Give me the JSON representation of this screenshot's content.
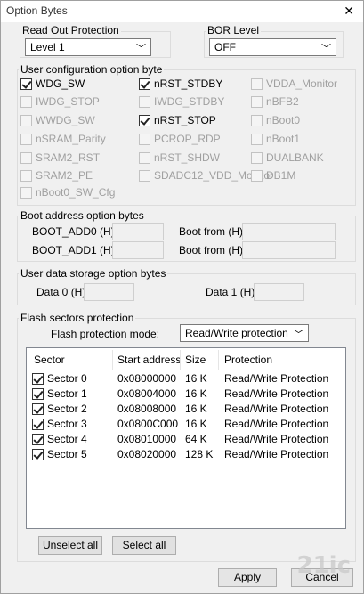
{
  "window": {
    "title": "Option Bytes"
  },
  "rop": {
    "label": "Read Out Protection",
    "value": "Level 1"
  },
  "bor": {
    "label": "BOR Level",
    "value": "OFF"
  },
  "user_config": {
    "title": "User configuration option byte",
    "options": [
      {
        "label": "WDG_SW",
        "checked": true,
        "enabled": true
      },
      {
        "label": "nRST_STDBY",
        "checked": true,
        "enabled": true
      },
      {
        "label": "VDDA_Monitor",
        "checked": false,
        "enabled": false
      },
      {
        "label": "IWDG_STOP",
        "checked": false,
        "enabled": false
      },
      {
        "label": "IWDG_STDBY",
        "checked": false,
        "enabled": false
      },
      {
        "label": "nBFB2",
        "checked": false,
        "enabled": false
      },
      {
        "label": "WWDG_SW",
        "checked": false,
        "enabled": false
      },
      {
        "label": "nRST_STOP",
        "checked": true,
        "enabled": true
      },
      {
        "label": "nBoot0",
        "checked": false,
        "enabled": false
      },
      {
        "label": "nSRAM_Parity",
        "checked": false,
        "enabled": false
      },
      {
        "label": "PCROP_RDP",
        "checked": false,
        "enabled": false
      },
      {
        "label": "nBoot1",
        "checked": false,
        "enabled": false
      },
      {
        "label": "SRAM2_RST",
        "checked": false,
        "enabled": false
      },
      {
        "label": "nRST_SHDW",
        "checked": false,
        "enabled": false
      },
      {
        "label": "DUALBANK",
        "checked": false,
        "enabled": false
      },
      {
        "label": "SRAM2_PE",
        "checked": false,
        "enabled": false
      },
      {
        "label": "SDADC12_VDD_Monitor",
        "checked": false,
        "enabled": false
      },
      {
        "label": "DB1M",
        "checked": false,
        "enabled": false
      },
      {
        "label": "nBoot0_SW_Cfg",
        "checked": false,
        "enabled": false
      }
    ]
  },
  "boot": {
    "title": "Boot address option bytes",
    "add0_label": "BOOT_ADD0 (H)",
    "add1_label": "BOOT_ADD1 (H)",
    "from_label_0": "Boot from (H)",
    "from_label_1": "Boot from (H)"
  },
  "user_data": {
    "title": "User data storage option bytes",
    "data0_label": "Data 0 (H)",
    "data1_label": "Data 1 (H)"
  },
  "flash": {
    "title": "Flash sectors protection",
    "mode_label": "Flash protection mode:",
    "mode_value": "Read/Write protection",
    "columns": [
      "Sector",
      "Start address",
      "Size",
      "Protection"
    ],
    "rows": [
      {
        "sector": "Sector 0",
        "address": "0x08000000",
        "size": "16 K",
        "protection": "Read/Write Protection",
        "checked": true
      },
      {
        "sector": "Sector 1",
        "address": "0x08004000",
        "size": "16 K",
        "protection": "Read/Write Protection",
        "checked": true
      },
      {
        "sector": "Sector 2",
        "address": "0x08008000",
        "size": "16 K",
        "protection": "Read/Write Protection",
        "checked": true
      },
      {
        "sector": "Sector 3",
        "address": "0x0800C000",
        "size": "16 K",
        "protection": "Read/Write Protection",
        "checked": true
      },
      {
        "sector": "Sector 4",
        "address": "0x08010000",
        "size": "64 K",
        "protection": "Read/Write Protection",
        "checked": true
      },
      {
        "sector": "Sector 5",
        "address": "0x08020000",
        "size": "128 K",
        "protection": "Read/Write Protection",
        "checked": true
      }
    ],
    "unselect_all": "Unselect all",
    "select_all": "Select all"
  },
  "footer": {
    "apply": "Apply",
    "cancel": "Cancel"
  },
  "watermark": "21ic"
}
